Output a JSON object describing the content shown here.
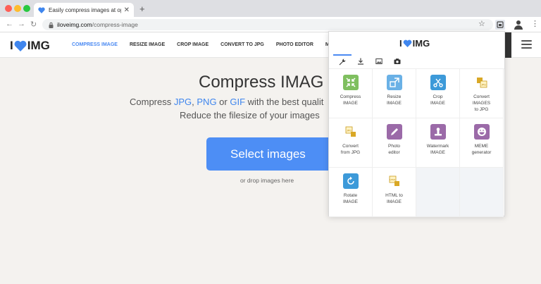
{
  "browser": {
    "tab_title": "Easily compress images at optim",
    "new_tab": "+",
    "close_tab": "✕",
    "url_host": "iloveimg.com",
    "url_path": "/compress-image"
  },
  "site": {
    "logo_left": "I",
    "logo_right": "IMG",
    "brand_color": "#3f86ee",
    "menu": [
      {
        "label": "COMPRESS IMAGE",
        "active": true
      },
      {
        "label": "RESIZE IMAGE"
      },
      {
        "label": "CROP IMAGE"
      },
      {
        "label": "CONVERT TO JPG"
      },
      {
        "label": "PHOTO EDITOR"
      },
      {
        "label": "M"
      }
    ]
  },
  "hero": {
    "title": "Compress IMAG",
    "sub1_a": "Compress ",
    "sub1_jpg": "JPG",
    "sub1_b": ", ",
    "sub1_png": "PNG",
    "sub1_c": " or ",
    "sub1_gif": "GIF",
    "sub1_d": " with the best qualit",
    "sub2": "Reduce the filesize of your images",
    "button": "Select images",
    "drop_hint": "or drop images here"
  },
  "popup": {
    "logo_left": "I",
    "logo_right": "IMG",
    "tabs": [
      "wrench-icon",
      "download-icon",
      "image-icon",
      "camera-icon"
    ],
    "tools": [
      {
        "label_lines": [
          "Compress",
          "IMAGE"
        ],
        "color": "#7fbf5f",
        "icon": "compress-icon"
      },
      {
        "label_lines": [
          "Resize",
          "IMAGE"
        ],
        "color": "#6ab1e6",
        "icon": "resize-icon"
      },
      {
        "label_lines": [
          "Crop",
          "IMAGE"
        ],
        "color": "#3d9ad9",
        "icon": "crop-icon"
      },
      {
        "label_lines": [
          "Convert",
          "IMAGES",
          "to JPG"
        ],
        "color": "#e8c23b",
        "icon": "convert-to-jpg-icon"
      },
      {
        "label_lines": [
          "Convert",
          "from JPG"
        ],
        "color": "#e8c23b",
        "icon": "convert-from-jpg-icon"
      },
      {
        "label_lines": [
          "Photo",
          "editor"
        ],
        "color": "#9b6aa8",
        "icon": "photo-editor-icon"
      },
      {
        "label_lines": [
          "Watermark",
          "IMAGE"
        ],
        "color": "#9b6aa8",
        "icon": "watermark-icon"
      },
      {
        "label_lines": [
          "MEME",
          "generator"
        ],
        "color": "#9b6aa8",
        "icon": "meme-icon"
      },
      {
        "label_lines": [
          "Rotate",
          "IMAGE"
        ],
        "color": "#3d9ad9",
        "icon": "rotate-icon"
      },
      {
        "label_lines": [
          "HTML to",
          "IMAGE"
        ],
        "color": "#e8c23b",
        "icon": "html-to-image-icon"
      }
    ]
  }
}
